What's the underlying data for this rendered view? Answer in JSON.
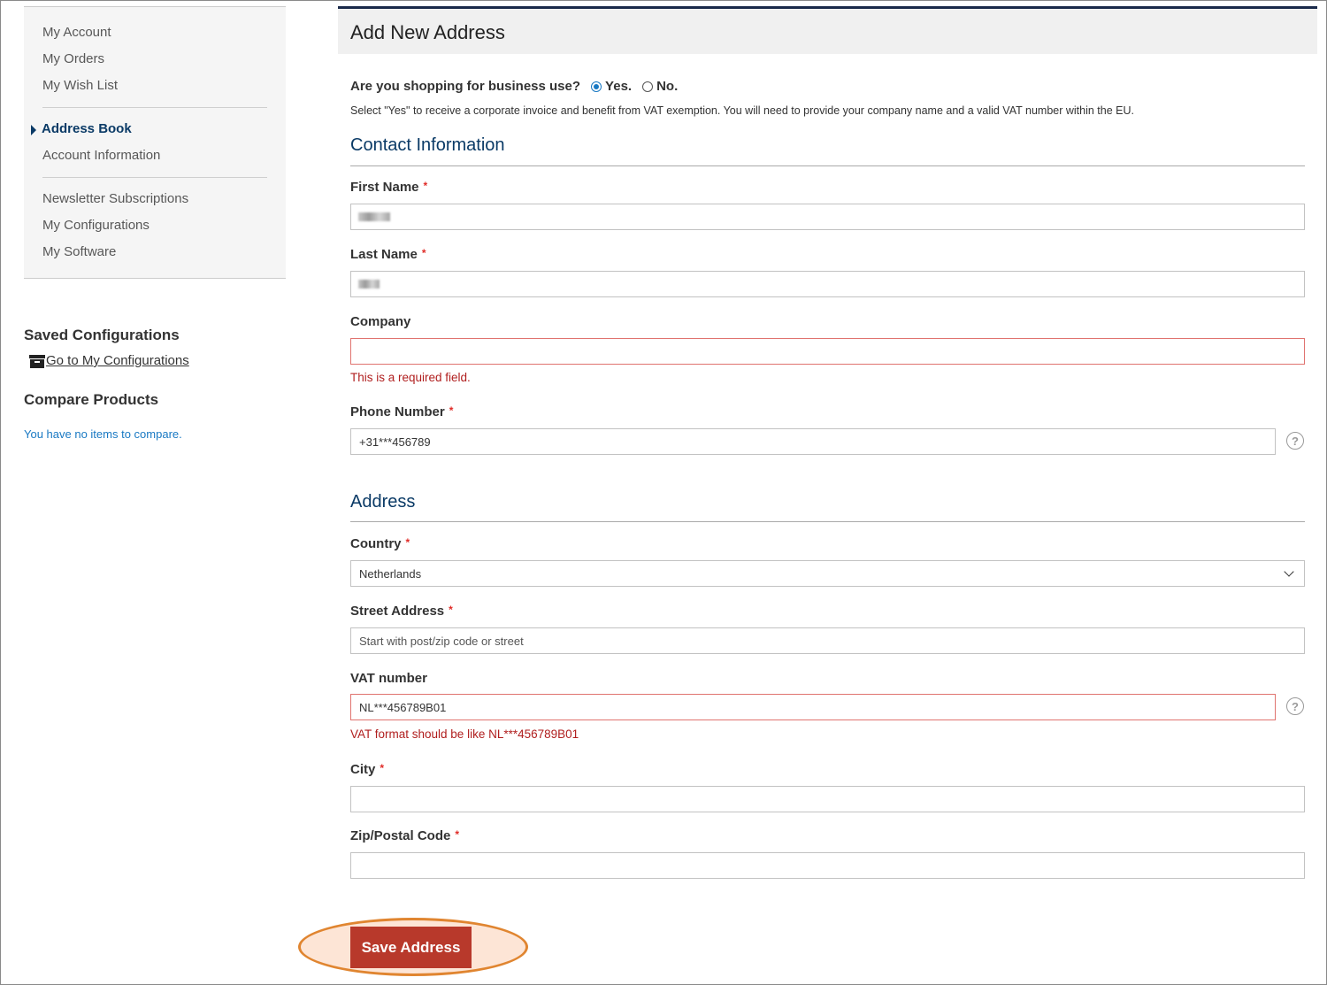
{
  "sidebar": {
    "nav": [
      {
        "label": "My Account"
      },
      {
        "label": "My Orders"
      },
      {
        "label": "My Wish List"
      },
      {
        "label": "Address Book"
      },
      {
        "label": "Account Information"
      },
      {
        "label": "Newsletter Subscriptions"
      },
      {
        "label": "My Configurations"
      },
      {
        "label": "My Software"
      }
    ],
    "active_item": "Address Book",
    "saved_configurations": {
      "heading": "Saved Configurations",
      "link": "Go to My Configurations"
    },
    "compare_products": {
      "heading": "Compare Products",
      "empty_text": "You have no items to compare."
    }
  },
  "page": {
    "title": "Add New Address",
    "business": {
      "question": "Are you shopping for business use?",
      "yes_label": "Yes.",
      "no_label": "No.",
      "selected": "Yes.",
      "note": "Select \"Yes\" to receive a corporate invoice and benefit from VAT exemption. You will need to provide your company name and a valid VAT number within the EU."
    },
    "contact_section": "Contact Information",
    "address_section": "Address",
    "fields": {
      "first_name": {
        "label": "First Name",
        "required": "*",
        "value": ""
      },
      "last_name": {
        "label": "Last Name",
        "required": "*",
        "value": ""
      },
      "company": {
        "label": "Company",
        "value": "",
        "error": "This is a required field."
      },
      "phone": {
        "label": "Phone Number",
        "required": "*",
        "value": "+31***456789"
      },
      "country": {
        "label": "Country",
        "required": "*",
        "value": "Netherlands"
      },
      "street": {
        "label": "Street Address",
        "required": "*",
        "placeholder": "Start with post/zip code or street"
      },
      "vat": {
        "label": "VAT number",
        "value": "NL***456789B01",
        "error": "VAT format should be like NL***456789B01"
      },
      "city": {
        "label": "City",
        "required": "*",
        "value": ""
      },
      "zip": {
        "label": "Zip/Postal Code",
        "required": "*",
        "value": ""
      }
    },
    "help_glyph": "?",
    "save_button": "Save Address"
  },
  "colors": {
    "accent_blue": "#0a3a66",
    "link_blue": "#1979c3",
    "error_red": "#b01e1e",
    "button_red": "#b8392b",
    "highlight_orange": "#e08530"
  }
}
